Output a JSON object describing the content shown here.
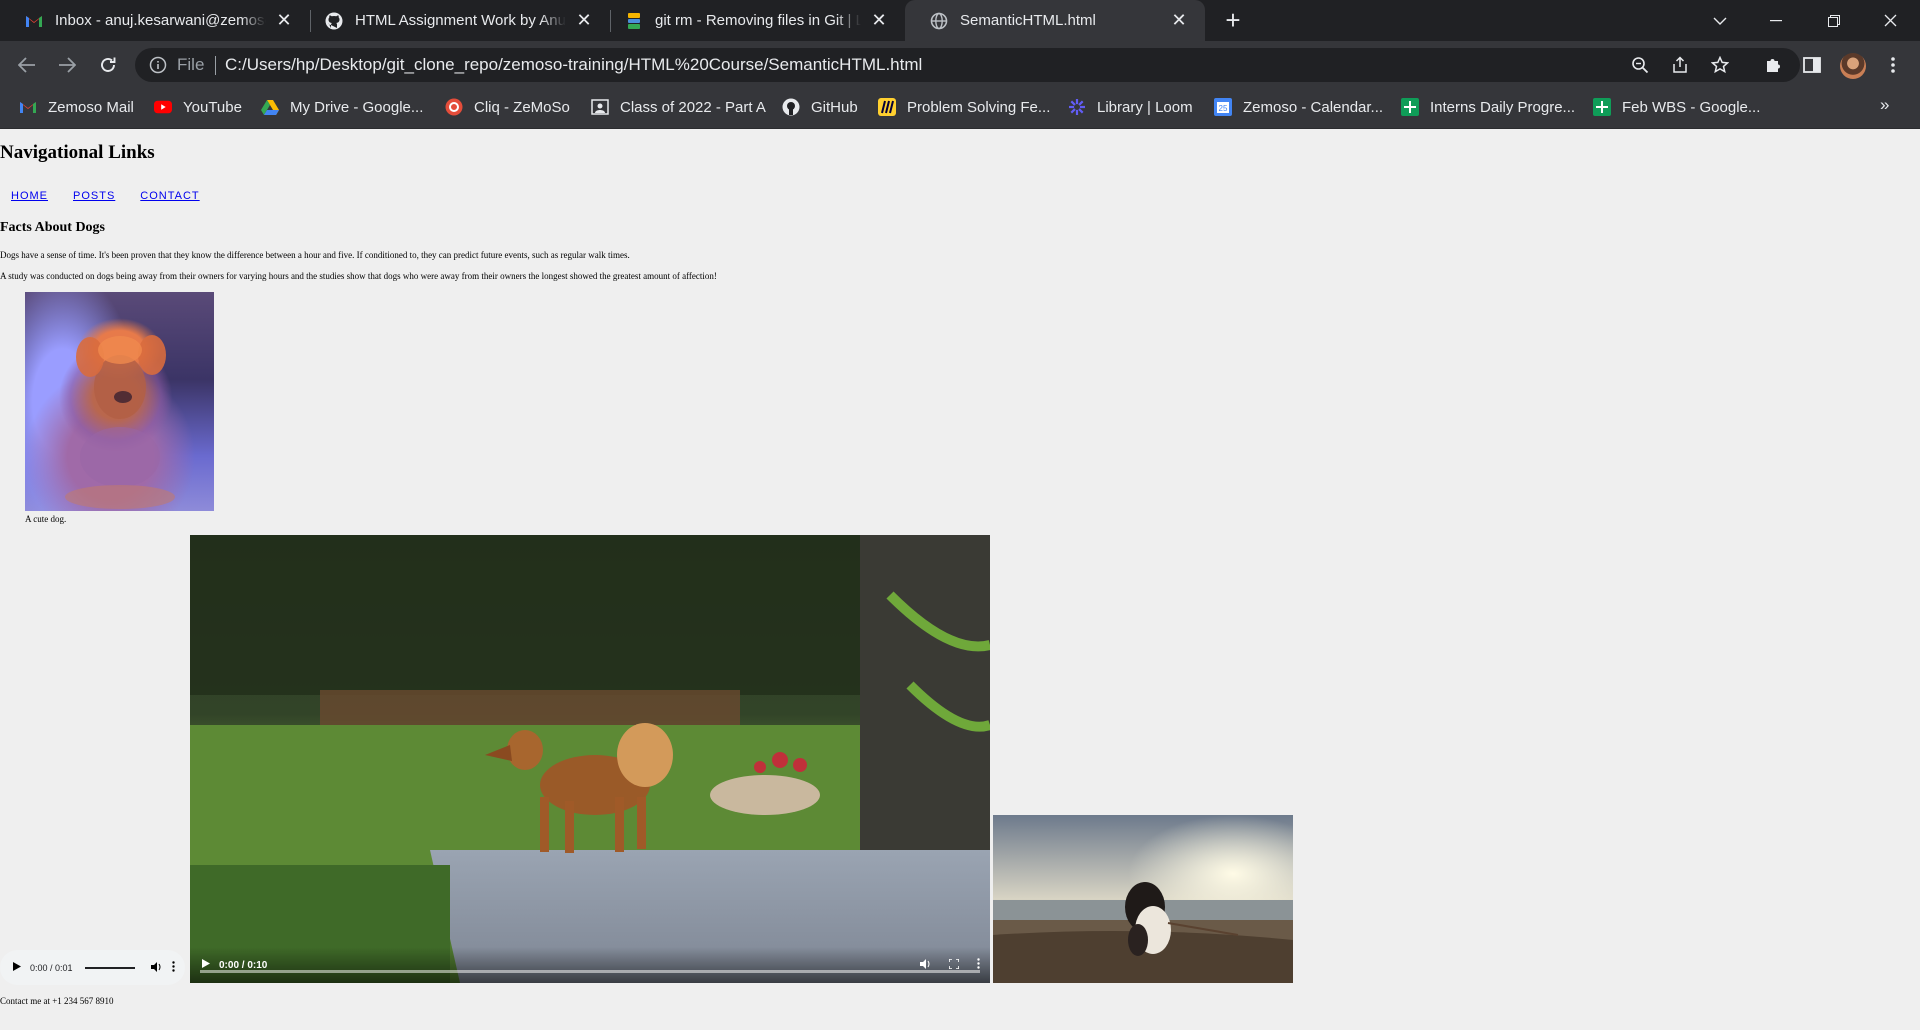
{
  "browser": {
    "tabs": [
      {
        "title": "Inbox - anuj.kesarwani@zemoso",
        "icon": "gmail-icon"
      },
      {
        "title": "HTML Assignment Work by Anuj",
        "icon": "github-icon"
      },
      {
        "title": "git rm - Removing files in Git | Le",
        "icon": "bookmark-site-icon"
      },
      {
        "title": "SemanticHTML.html",
        "icon": "globe-icon"
      }
    ],
    "omnibox": {
      "scheme_label": "File",
      "url": "C:/Users/hp/Desktop/git_clone_repo/zemoso-training/HTML%20Course/SemanticHTML.html"
    },
    "bookmarks": [
      {
        "label": "Zemoso Mail",
        "icon": "gmail-icon"
      },
      {
        "label": "YouTube",
        "icon": "youtube-icon"
      },
      {
        "label": "My Drive - Google...",
        "icon": "drive-icon"
      },
      {
        "label": "Cliq - ZeMoSo",
        "icon": "cliq-icon"
      },
      {
        "label": "Class of 2022 - Part A",
        "icon": "classroom-icon"
      },
      {
        "label": "GitHub",
        "icon": "github-icon"
      },
      {
        "label": "Problem Solving Fe...",
        "icon": "miro-icon"
      },
      {
        "label": "Library | Loom",
        "icon": "loom-icon"
      },
      {
        "label": "Zemoso - Calendar...",
        "icon": "calendar-icon"
      },
      {
        "label": "Interns Daily Progre...",
        "icon": "sheets-icon"
      },
      {
        "label": "Feb WBS - Google...",
        "icon": "sheets-icon"
      }
    ],
    "more_label": "»"
  },
  "page": {
    "nav_heading": "Navigational Links",
    "nav_links": [
      "HOME",
      "POSTS",
      "CONTACT"
    ],
    "facts_heading": "Facts About Dogs",
    "paragraphs": [
      "Dogs have a sense of time. It's been proven that they know the difference between a hour and five. If conditioned to, they can predict future events, such as regular walk times.",
      "A study was conducted on dogs being away from their owners for varying hours and the studies show that dogs who were away from their owners the longest showed the greatest amount of affection!"
    ],
    "figure_caption": "A cute dog.",
    "audio_time": "0:00 / 0:01",
    "video_time": "0:00 / 0:10",
    "contact": "Contact me at +1 234 567 8910"
  }
}
